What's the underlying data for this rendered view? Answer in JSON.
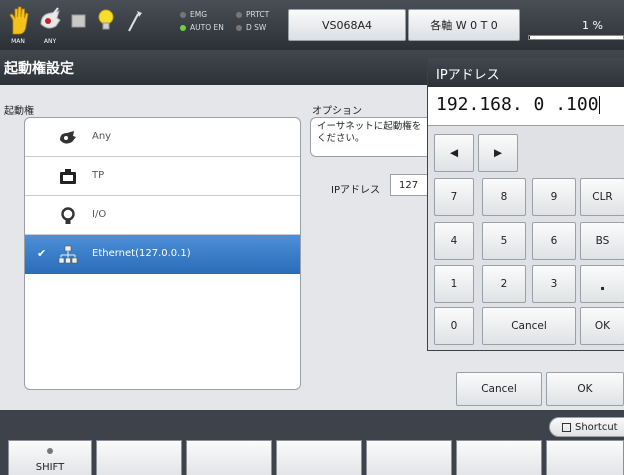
{
  "toolbar": {
    "mode_labels": {
      "man": "MAN",
      "any": "ANY"
    },
    "status": {
      "emg": "EMG",
      "prtct": "PRTCT",
      "auto_en": "AUTO EN",
      "dsw": "D SW"
    },
    "robot_name": "VS068A4",
    "axis_label": "各軸 W 0 T 0",
    "speed_label": "1 %",
    "speed_level_percent": 1
  },
  "window_title": "起動権設定",
  "left": {
    "header": "起動権",
    "items": [
      {
        "label": "Any",
        "icon": "teach-pendant-any-icon",
        "selected": false
      },
      {
        "label": "TP",
        "icon": "teach-pendant-icon",
        "selected": false
      },
      {
        "label": "I/O",
        "icon": "io-bulb-icon",
        "selected": false
      },
      {
        "label": "Ethernet(127.0.0.1)",
        "icon": "network-icon",
        "selected": true
      }
    ]
  },
  "options": {
    "header": "オプション",
    "line1": "イーサネットに起動権を",
    "line2": "ください。",
    "ip_label": "IPアドレス",
    "ip_first_octet": "127"
  },
  "keypad": {
    "title": "IPアドレス",
    "value": "192.168. 0 .100",
    "keys": {
      "left": "◀",
      "right": "▶",
      "n7": "7",
      "n8": "8",
      "n9": "9",
      "clr": "CLR",
      "n4": "4",
      "n5": "5",
      "n6": "6",
      "bs": "BS",
      "n1": "1",
      "n2": "2",
      "n3": "3",
      "dot": ".",
      "n0": "0",
      "cancel": "Cancel",
      "ok": "OK"
    }
  },
  "dialog": {
    "cancel": "Cancel",
    "ok": "OK"
  },
  "shortcut_label": "Shortcut",
  "fkeys": {
    "shift": "SHIFT"
  },
  "colors": {
    "selection": "#2a6cb8",
    "status_on": "#6ed23a",
    "status_off": "#777777",
    "header_bg": "#2e3238"
  }
}
